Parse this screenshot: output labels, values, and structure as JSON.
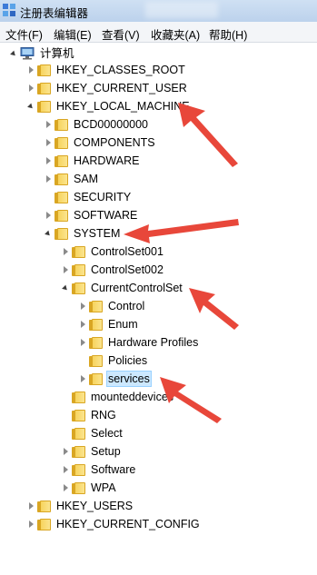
{
  "window": {
    "title": "注册表编辑器"
  },
  "menu": [
    "文件(F)",
    "编辑(E)",
    "查看(V)",
    "收藏夹(A)",
    "帮助(H)"
  ],
  "tree": {
    "root": "计算机",
    "hkcr": "HKEY_CLASSES_ROOT",
    "hkcu": "HKEY_CURRENT_USER",
    "hklm": "HKEY_LOCAL_MACHINE",
    "bcd": "BCD00000000",
    "components": "COMPONENTS",
    "hardware": "HARDWARE",
    "sam": "SAM",
    "security": "SECURITY",
    "software": "SOFTWARE",
    "system": "SYSTEM",
    "cs001": "ControlSet001",
    "cs002": "ControlSet002",
    "ccs": "CurrentControlSet",
    "control": "Control",
    "enum": "Enum",
    "hwprofiles": "Hardware Profiles",
    "policies": "Policies",
    "services": "services",
    "mounteddevices": "mounteddevices",
    "rng": "RNG",
    "select": "Select",
    "setup": "Setup",
    "software2": "Software",
    "wpa": "WPA",
    "hku": "HKEY_USERS",
    "hkcc": "HKEY_CURRENT_CONFIG"
  },
  "colors": {
    "arrow": "#e8473a",
    "selection": "#cce8ff",
    "folder": "#f7d35d"
  }
}
